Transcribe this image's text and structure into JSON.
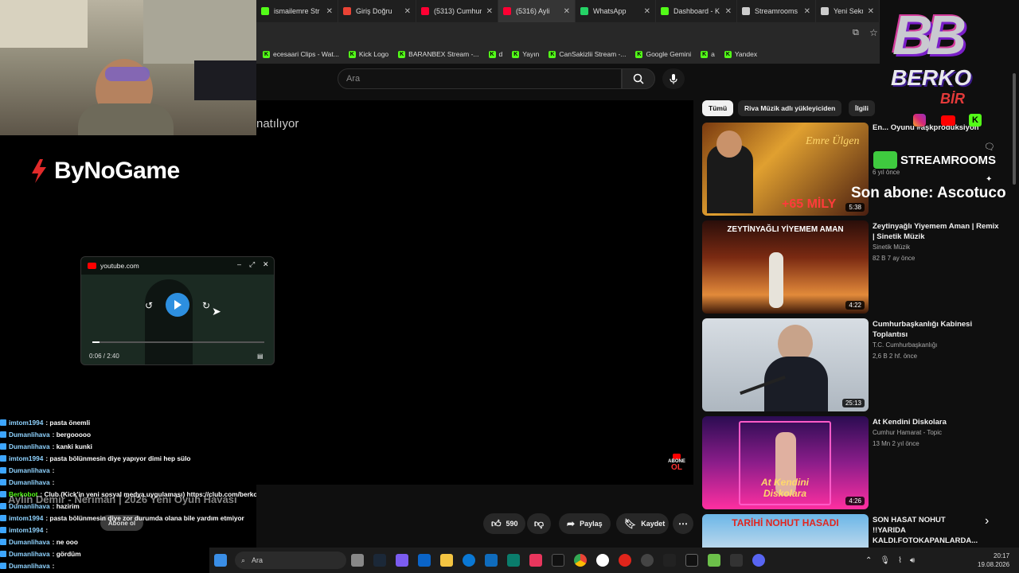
{
  "browser": {
    "tabs": [
      {
        "label": "ismailemre Str",
        "color": "#53fc18",
        "active": false
      },
      {
        "label": "Giriş Doğru",
        "color": "#ea4335",
        "active": false
      },
      {
        "label": "(5313) Cumhur",
        "color": "#ff0033",
        "active": false
      },
      {
        "label": "(5316) Ayli",
        "color": "#ff0033",
        "active": true
      },
      {
        "label": "WhatsApp",
        "color": "#25d366",
        "active": false
      },
      {
        "label": "Dashboard - K",
        "color": "#53fc18",
        "active": false
      },
      {
        "label": "Streamrooms",
        "color": "#cccccc",
        "active": false
      },
      {
        "label": "Yeni Sekme",
        "color": "#cccccc",
        "active": false
      }
    ],
    "bookmarks": [
      {
        "label": "ecesaari Clips - Wat..."
      },
      {
        "label": "Kick Logo"
      },
      {
        "label": "BARANBEX Stream -..."
      },
      {
        "label": "d"
      },
      {
        "label": "Yayın"
      },
      {
        "label": "CanSakizlii Stream -..."
      },
      {
        "label": "Google Gemini"
      },
      {
        "label": "a"
      },
      {
        "label": "Yandex"
      }
    ]
  },
  "youtube": {
    "search_placeholder": "Ara",
    "player_status": "natılıyor",
    "chips": [
      "Tümü",
      "Riva Müzik adlı yükleyiciden",
      "İlgili"
    ],
    "recommendations": [
      {
        "title": "En... Oyunu #aşkprodüksiyon",
        "channel": "",
        "meta": "6 yıl önce",
        "duration": "5:38",
        "overlay": "+65 MİLY"
      },
      {
        "title": "Zeytinyağlı Yiyemem Aman | Remix | Sinetik Müzik",
        "channel": "Sinetik Müzik",
        "meta": "82 B  7 ay önce",
        "duration": "4:22",
        "overlay": "ZEYTİNYAĞLI YİYEMEM AMAN"
      },
      {
        "title": "Cumhurbaşkanlığı Kabinesi Toplantısı",
        "channel": "T.C. Cumhurbaşkanlığı",
        "meta": "2,6 B  2 hf. önce",
        "duration": "25:13",
        "overlay": ""
      },
      {
        "title": "At Kendini Diskolara",
        "channel": "Cumhur Hamarat - Topic",
        "meta": "13 Mn  2 yıl önce",
        "duration": "4:26",
        "overlay": "At Kendini Diskolara"
      },
      {
        "title": "SON HASAT NOHUT !!YARIDA KALDI.FOTOKAPANLARDA...",
        "channel": "",
        "meta": "",
        "duration": "",
        "overlay": "TARİHİ NOHUT HASADI"
      }
    ],
    "video_title": "Aylin Demir - Nerimän | 2026 Yeni Oyun Havası",
    "actions": {
      "likes": "590",
      "share": "Paylaş",
      "save": "Kaydet"
    },
    "subscribe_hint": "Abone ol"
  },
  "mini_player": {
    "domain": "youtube.com",
    "time": "0:06 / 2:40",
    "progress": 0.04
  },
  "overlay": {
    "sponsor": "ByNoGame",
    "brand_top": "BERKO",
    "brand_bottom": "BİR",
    "streamrooms": "STREAMROOMS",
    "last_sub": "Son abone: Ascotuco"
  },
  "chat": [
    {
      "user": "imtom1994",
      "msg": ": pasta önemli"
    },
    {
      "user": "Dumanlihava",
      "msg": ": bergooooo"
    },
    {
      "user": "Dumanlihava",
      "msg": ": kanki kunki"
    },
    {
      "user": "imtom1994",
      "msg": ": pasta bölünmesin diye yapıyor dimi hep sülo"
    },
    {
      "user": "Dumanlihava",
      "msg": ":"
    },
    {
      "user": "Dumanlihava",
      "msg": ":"
    },
    {
      "user": "Berkobot",
      "msg": ": Club (Kick'in yeni sosyal medya uygulaması) https://club.com/berkobir",
      "bot": true
    },
    {
      "user": "Dumanlihava",
      "msg": ": hazirim"
    },
    {
      "user": "imtom1994",
      "msg": ": pasta bölünmesin diye zor durumda olana bile yardım etmiyor"
    },
    {
      "user": "imtom1994",
      "msg": ":"
    },
    {
      "user": "Dumanlihava",
      "msg": ": ne ooo"
    },
    {
      "user": "Dumanlihava",
      "msg": ": gördüm"
    },
    {
      "user": "Dumanlihava",
      "msg": ":"
    }
  ],
  "taskbar": {
    "search": "Ara",
    "time": "20:17",
    "date": "19.08.2026"
  }
}
